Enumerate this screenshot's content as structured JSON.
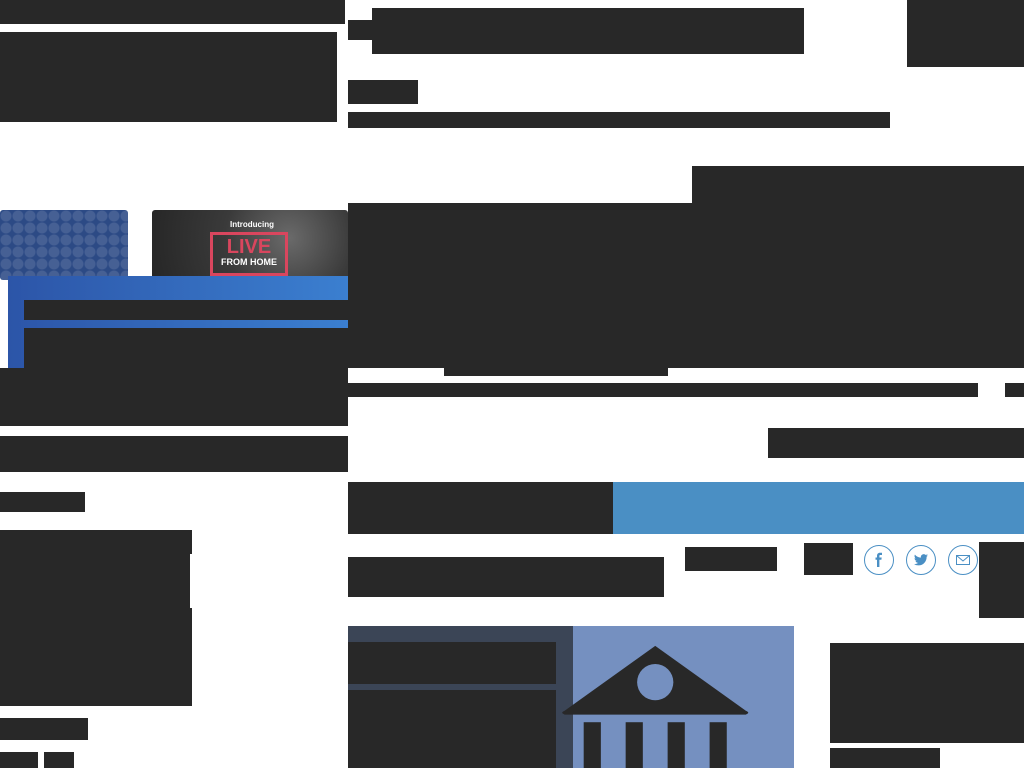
{
  "promo": {
    "intro": "Introducing",
    "word": "LIVE",
    "sub": "FROM HOME"
  },
  "share": {
    "facebook_icon": "facebook-icon",
    "twitter_icon": "twitter-icon",
    "email_icon": "email-icon"
  },
  "hero": {
    "icon": "bank-building-icon"
  },
  "colors": {
    "bar": "#282828",
    "accent": "#4a8fc4",
    "hero_bg": "#7590c0",
    "promo_red": "#d9465e",
    "banner_blue": "#2c55a8"
  }
}
